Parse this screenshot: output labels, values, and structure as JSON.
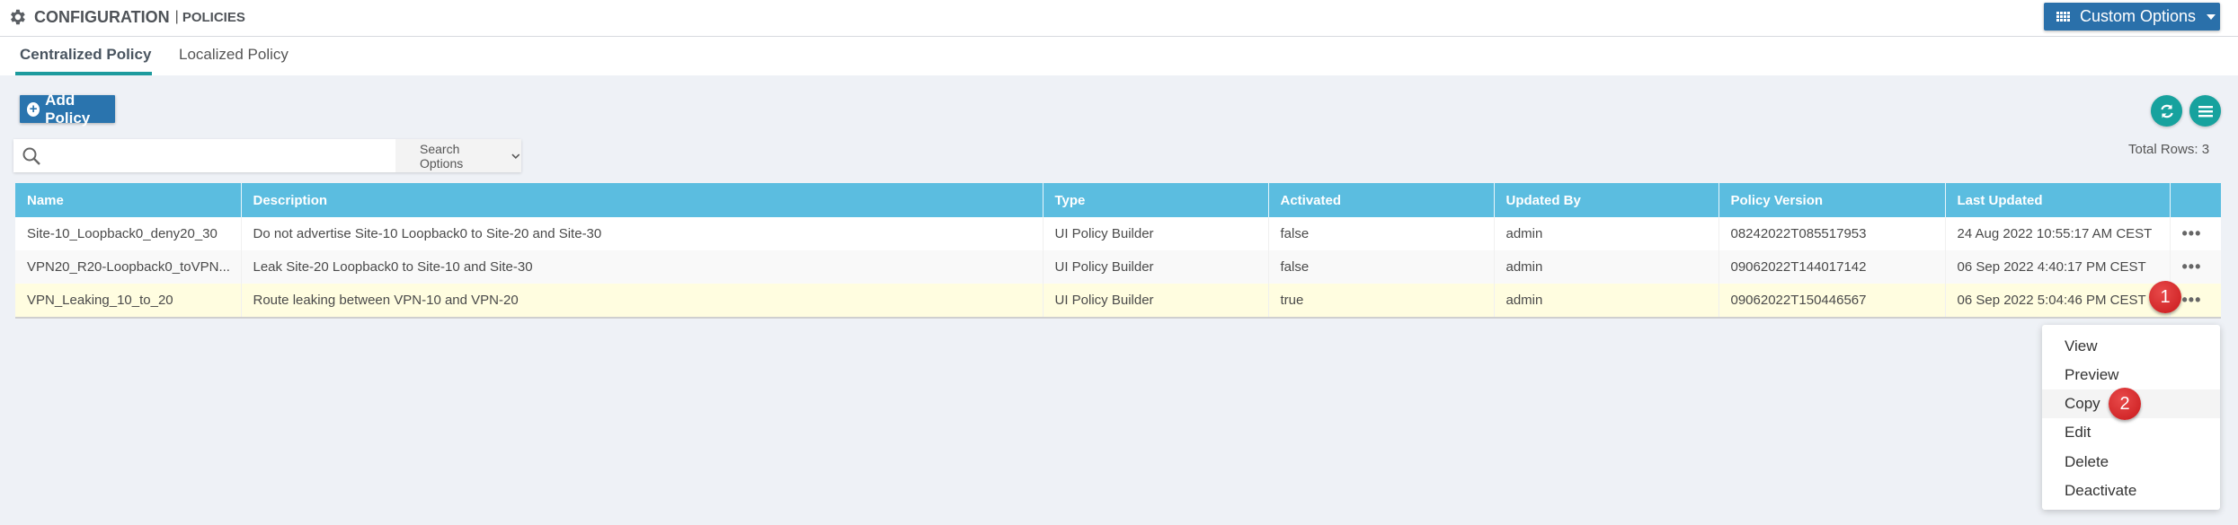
{
  "header": {
    "section": "CONFIGURATION",
    "separator": "|",
    "page": "POLICIES",
    "custom_options_label": "Custom Options"
  },
  "tabs": [
    {
      "label": "Centralized Policy",
      "active": true
    },
    {
      "label": "Localized Policy",
      "active": false
    }
  ],
  "toolbar": {
    "add_policy_label": "Add Policy",
    "search_placeholder": "",
    "search_options_label": "Search Options",
    "total_rows": "Total Rows: 3"
  },
  "table": {
    "columns": [
      "Name",
      "Description",
      "Type",
      "Activated",
      "Updated By",
      "Policy Version",
      "Last Updated",
      ""
    ],
    "rows": [
      {
        "name": "Site-10_Loopback0_deny20_30",
        "description": "Do not advertise Site-10 Loopback0 to Site-20 and Site-30",
        "type": "UI Policy Builder",
        "activated": "false",
        "updated_by": "admin",
        "policy_version": "08242022T085517953",
        "last_updated": "24 Aug 2022 10:55:17 AM CEST",
        "actions": "•••"
      },
      {
        "name": "VPN20_R20-Loopback0_toVPN...",
        "description": "Leak Site-20 Loopback0 to Site-10 and Site-30",
        "type": "UI Policy Builder",
        "activated": "false",
        "updated_by": "admin",
        "policy_version": "09062022T144017142",
        "last_updated": "06 Sep 2022 4:40:17 PM CEST",
        "actions": "•••"
      },
      {
        "name": "VPN_Leaking_10_to_20",
        "description": "Route leaking between VPN-10 and VPN-20",
        "type": "UI Policy Builder",
        "activated": "true",
        "updated_by": "admin",
        "policy_version": "09062022T150446567",
        "last_updated": "06 Sep 2022 5:04:46 PM CEST",
        "actions": "•••"
      }
    ]
  },
  "context_menu": {
    "items": [
      "View",
      "Preview",
      "Copy",
      "Edit",
      "Delete",
      "Deactivate"
    ],
    "hovered": "Copy"
  },
  "annotations": {
    "step1": "1",
    "step2": "2"
  },
  "colors": {
    "primary_button": "#2a74ae",
    "accent_teal": "#17a29e",
    "table_header": "#5bbde0",
    "selected_row": "#fffde0",
    "badge_red": "#d42a2a"
  }
}
